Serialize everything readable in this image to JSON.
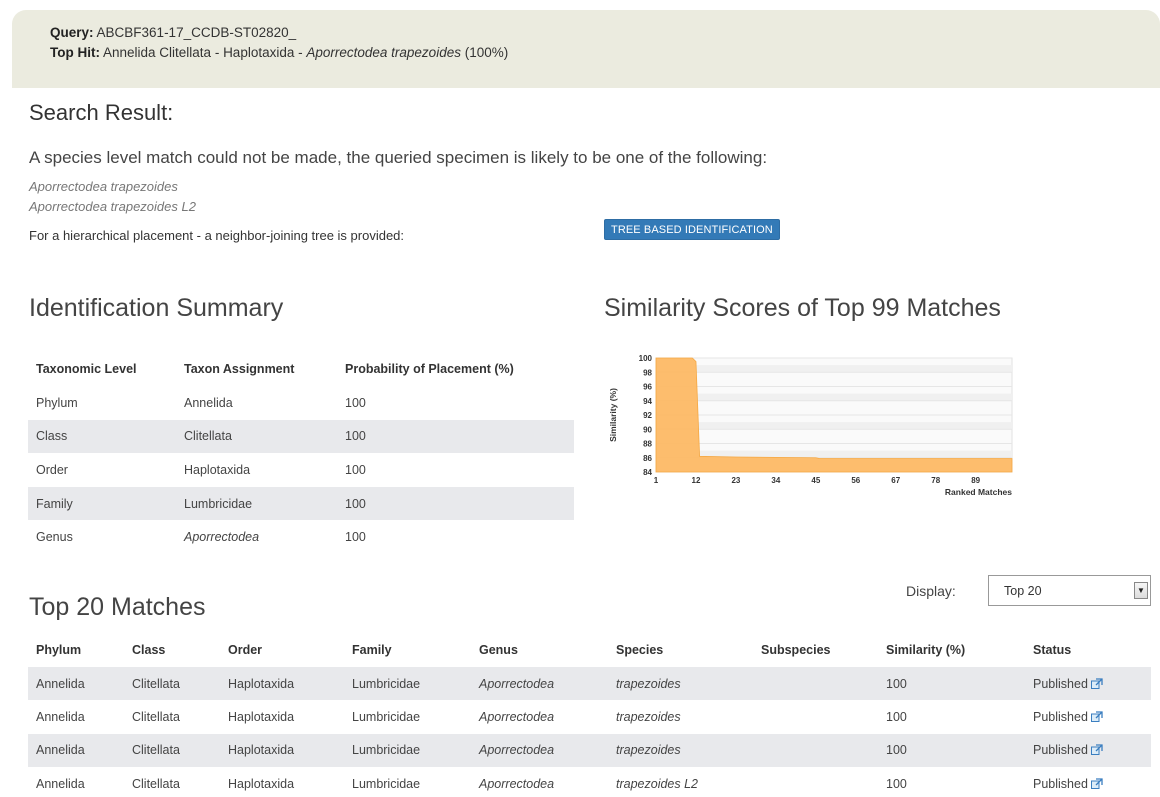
{
  "query": {
    "query_label": "Query:",
    "query_value": "ABCBF361-17_CCDB-ST02820_",
    "tophit_label": "Top Hit:",
    "tophit_taxa": "Annelida Clitellata - Haplotaxida - ",
    "tophit_species": "Aporrectodea trapezoides",
    "tophit_pct": " (100%)"
  },
  "search": {
    "heading": "Search Result:",
    "lead": "A species level match could not be made, the queried specimen is likely to be one of the following:",
    "candidates": [
      "Aporrectodea trapezoides",
      "Aporrectodea trapezoides L2"
    ],
    "tree_note": "For a hierarchical placement - a neighbor-joining tree is provided:",
    "tree_button": "TREE BASED IDENTIFICATION"
  },
  "id_summary": {
    "heading": "Identification Summary",
    "columns": [
      "Taxonomic Level",
      "Taxon Assignment",
      "Probability of Placement (%)"
    ],
    "rows": [
      [
        "Phylum",
        "Annelida",
        "100"
      ],
      [
        "Class",
        "Clitellata",
        "100"
      ],
      [
        "Order",
        "Haplotaxida",
        "100"
      ],
      [
        "Family",
        "Lumbricidae",
        "100"
      ],
      [
        "Genus",
        "Aporrectodea",
        "100"
      ]
    ]
  },
  "similarity": {
    "heading": "Similarity Scores of Top 99 Matches"
  },
  "chart_data": {
    "type": "area",
    "title": "",
    "xlabel": "Ranked Matches",
    "ylabel": "Similarity (%)",
    "x_ticks": [
      1,
      12,
      23,
      34,
      45,
      56,
      67,
      78,
      89
    ],
    "y_ticks": [
      84,
      86,
      88,
      90,
      92,
      94,
      96,
      98,
      100
    ],
    "xlim": [
      1,
      99
    ],
    "ylim": [
      84,
      100
    ],
    "grid": true,
    "series": [
      {
        "points": [
          [
            1,
            100
          ],
          [
            11,
            100
          ],
          [
            12,
            99.5
          ],
          [
            13,
            86.2
          ],
          [
            23,
            86.1
          ],
          [
            45,
            86.0
          ],
          [
            46,
            85.9
          ],
          [
            99,
            85.9
          ]
        ],
        "color": "#fdb965"
      }
    ]
  },
  "matches": {
    "heading": "Top 20 Matches",
    "display_label": "Display:",
    "display_value": "Top 20",
    "columns": [
      "Phylum",
      "Class",
      "Order",
      "Family",
      "Genus",
      "Species",
      "Subspecies",
      "Similarity (%)",
      "Status"
    ],
    "rows": [
      [
        "Annelida",
        "Clitellata",
        "Haplotaxida",
        "Lumbricidae",
        "Aporrectodea",
        "trapezoides",
        "",
        "100",
        "Published"
      ],
      [
        "Annelida",
        "Clitellata",
        "Haplotaxida",
        "Lumbricidae",
        "Aporrectodea",
        "trapezoides",
        "",
        "100",
        "Published"
      ],
      [
        "Annelida",
        "Clitellata",
        "Haplotaxida",
        "Lumbricidae",
        "Aporrectodea",
        "trapezoides",
        "",
        "100",
        "Published"
      ],
      [
        "Annelida",
        "Clitellata",
        "Haplotaxida",
        "Lumbricidae",
        "Aporrectodea",
        "trapezoides L2",
        "",
        "100",
        "Published"
      ]
    ]
  },
  "colors": {
    "accent": "#337ab7",
    "header_bg": "#ebebdf",
    "row_alt": "#e8e9ec",
    "chart_fill": "#fdb965"
  }
}
